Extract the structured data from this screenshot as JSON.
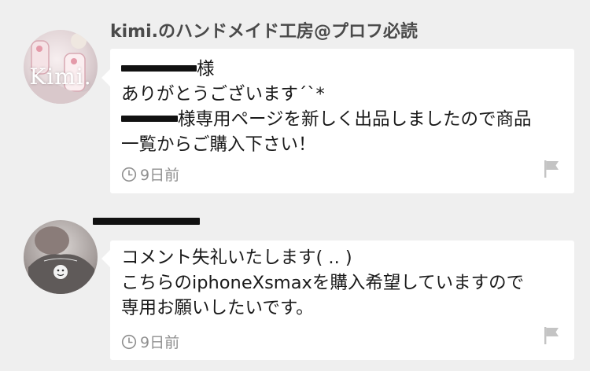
{
  "comments": [
    {
      "author": "kimi.のハンドメイド工房@プロフ必読",
      "avatar_text": "Kimi.",
      "lines": [
        {
          "before": "",
          "after": "様"
        },
        {
          "before": "",
          "text": "ありがとうございます´`*"
        },
        {
          "before": "",
          "after": "様専用ページを新しく出品しましたので商品"
        },
        {
          "before": "",
          "text": "一覧からご購入下さい！"
        }
      ],
      "time": "9日前"
    },
    {
      "author": "",
      "avatar_text": "",
      "lines": [
        {
          "text": "コメント失礼いたします( .. )"
        },
        {
          "text": "こちらのiphoneXsmaxを購入希望していますので"
        },
        {
          "text": "専用お願いしたいです。"
        }
      ],
      "time": "9日前"
    }
  ],
  "colors": {
    "background": "#efefef",
    "bubble": "#ffffff",
    "meta": "#8f8f8f",
    "author": "#4a4a4a"
  },
  "icons": {
    "time": "clock-icon",
    "report": "flag-icon"
  }
}
